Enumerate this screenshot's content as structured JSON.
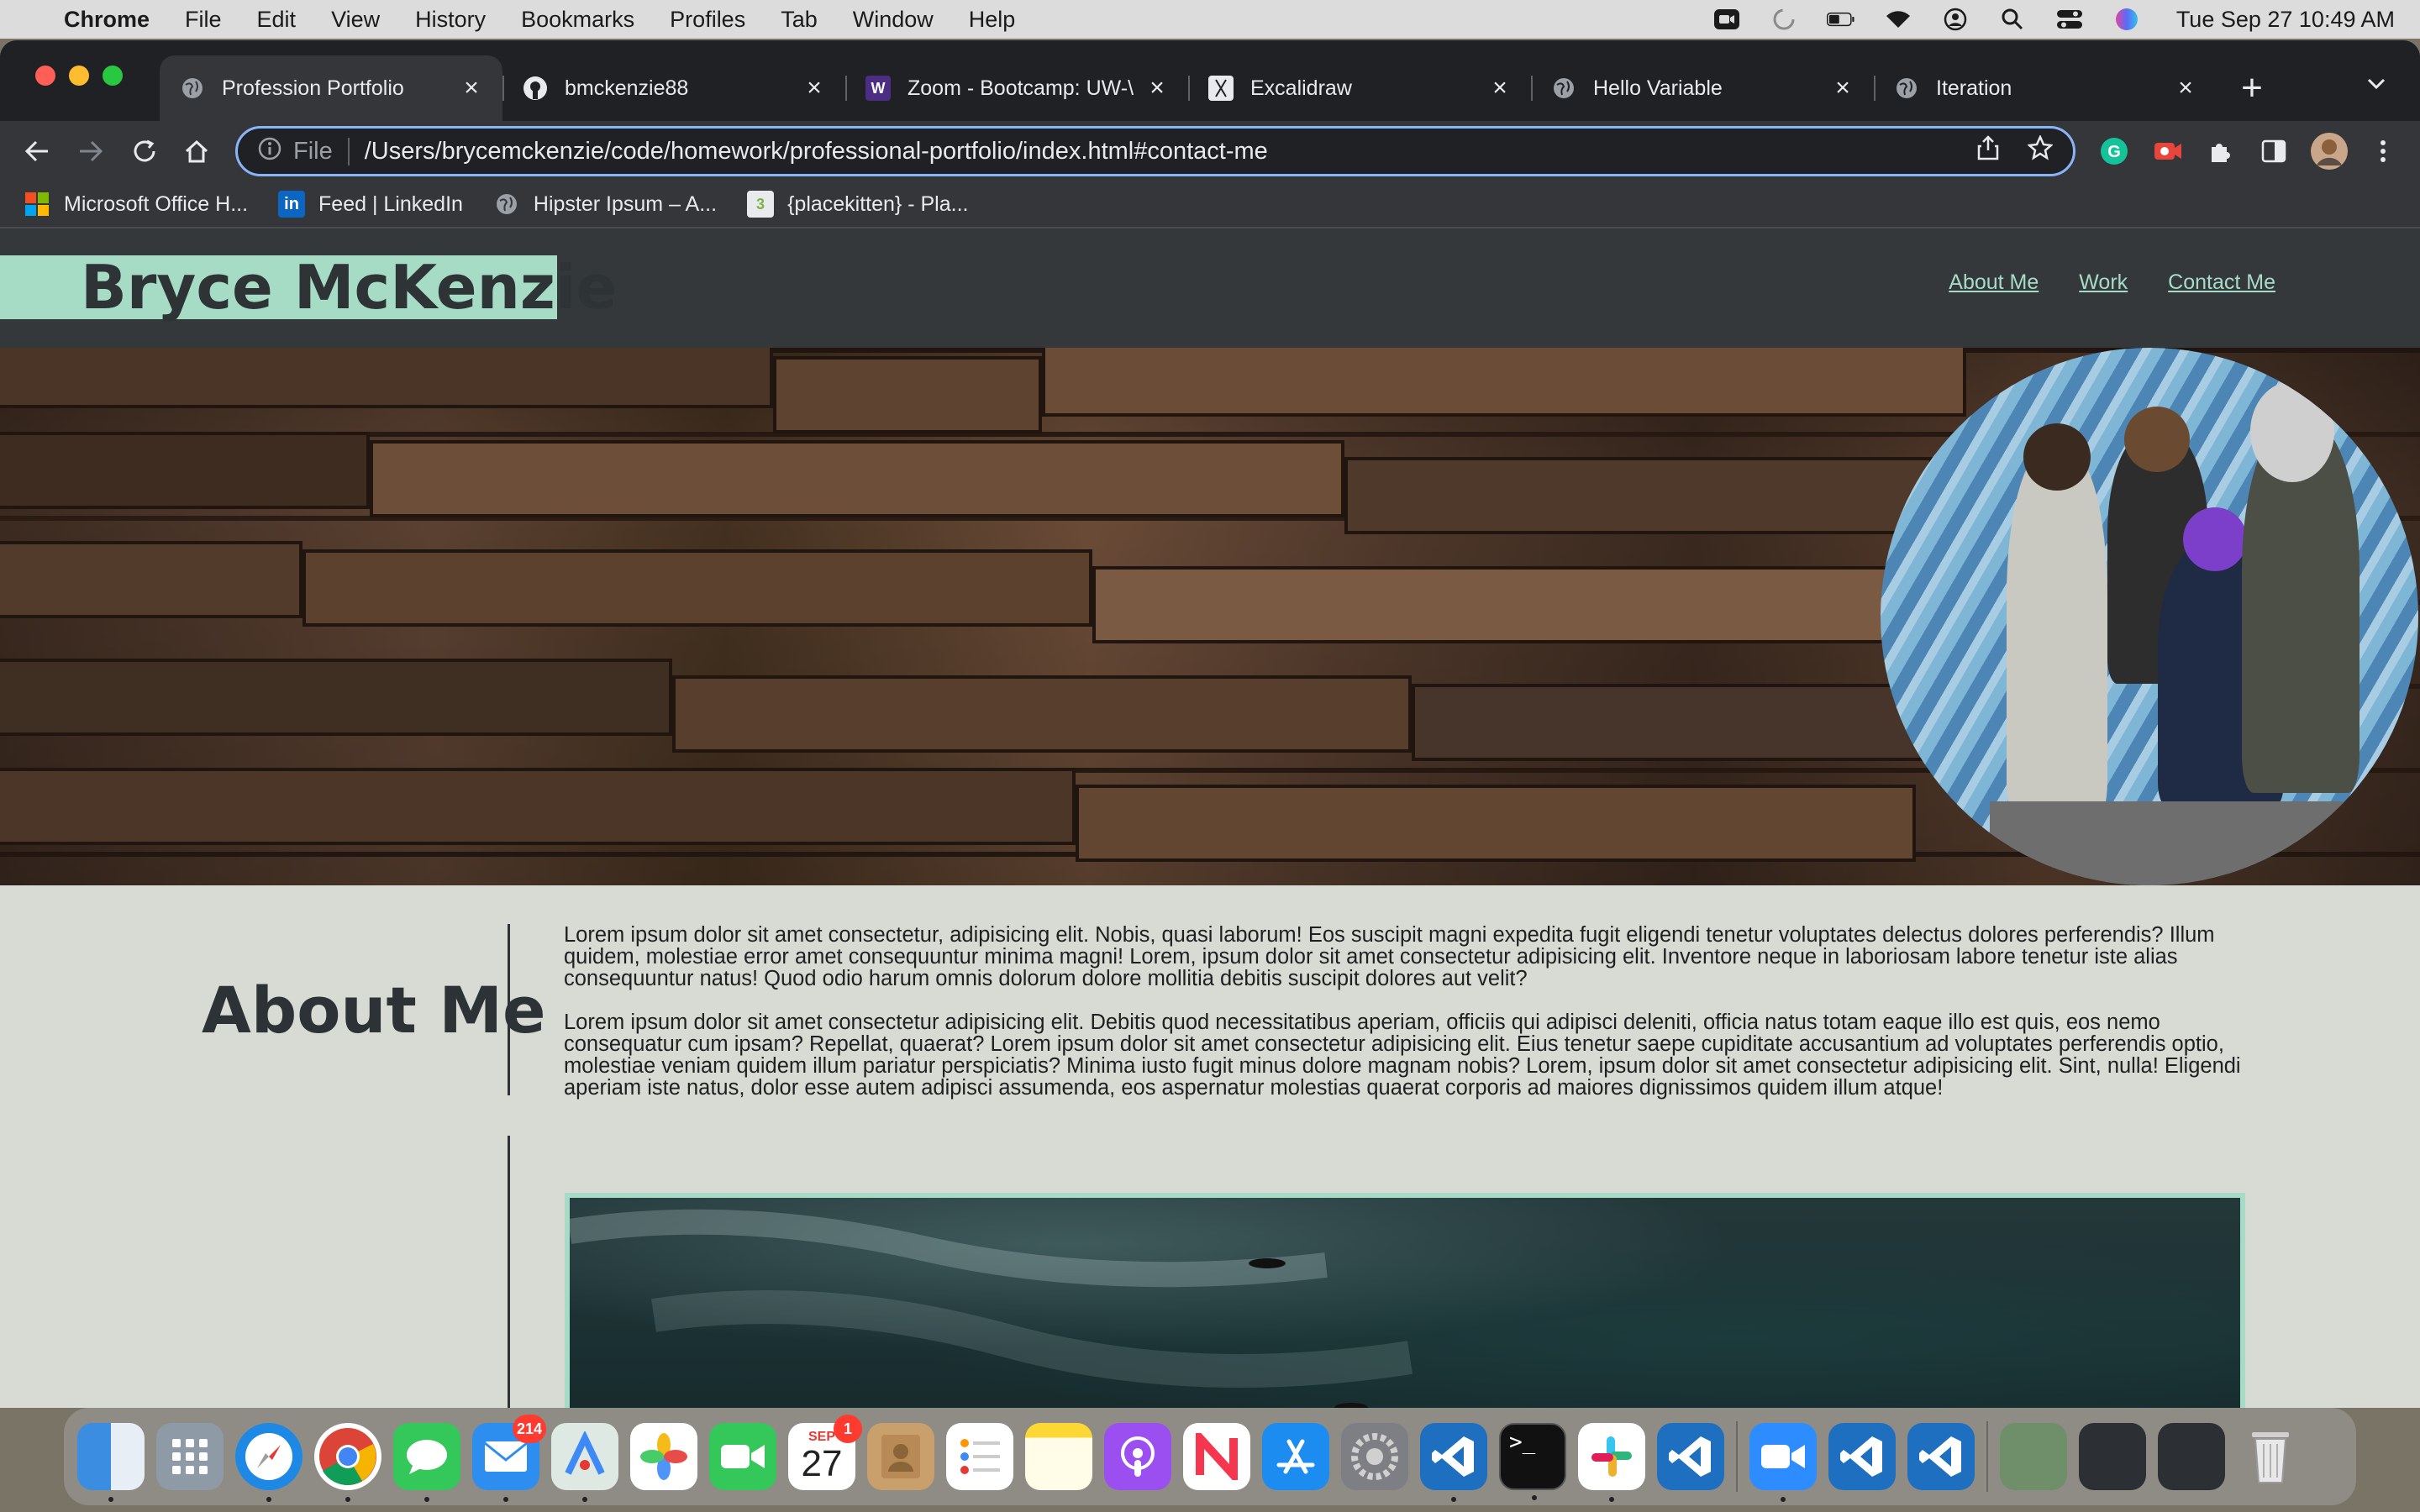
{
  "menubar": {
    "app": "Chrome",
    "items": [
      "File",
      "Edit",
      "View",
      "History",
      "Bookmarks",
      "Profiles",
      "Tab",
      "Window",
      "Help"
    ],
    "clock": "Tue Sep 27  10:49 AM"
  },
  "tabs": [
    {
      "title": "Profession Portfolio",
      "icon": "globe-icon"
    },
    {
      "title": "bmckenzie88",
      "icon": "github-icon"
    },
    {
      "title": "Zoom - Bootcamp: UW-\\",
      "icon": "w-logo-icon"
    },
    {
      "title": "Excalidraw",
      "icon": "excalidraw-icon"
    },
    {
      "title": "Hello Variable",
      "icon": "globe-icon"
    },
    {
      "title": "Iteration",
      "icon": "globe-icon"
    }
  ],
  "omnibox": {
    "scheme": "File",
    "url": "/Users/brycemckenzie/code/homework/professional-portfolio/index.html#contact-me"
  },
  "bookmarks": [
    {
      "label": "Microsoft Office H...",
      "icon": "microsoft-icon"
    },
    {
      "label": "Feed | LinkedIn",
      "icon": "linkedin-icon"
    },
    {
      "label": "Hipster Ipsum – A...",
      "icon": "globe-icon"
    },
    {
      "label": "{placekitten} - Pla...",
      "icon": "placekitten-icon"
    }
  ],
  "site": {
    "brand": "Bryce McKenzie",
    "nav": [
      "About Me",
      "Work",
      "Contact Me"
    ],
    "about_title": "About Me",
    "about_p1": "Lorem ipsum dolor sit amet consectetur, adipisicing elit. Nobis, quasi laborum! Eos suscipit magni expedita fugit eligendi tenetur voluptates delectus dolores perferendis? Illum quidem, molestiae error amet consequuntur minima magni! Lorem, ipsum dolor sit amet consectetur adipisicing elit. Inventore neque in laboriosam labore tenetur iste alias consequuntur natus! Quod odio harum omnis dolorum dolore mollitia debitis suscipit dolores aut velit?",
    "about_p2": "Lorem ipsum dolor sit amet consectetur adipisicing elit. Debitis quod necessitatibus aperiam, officiis qui adipisci deleniti, officia natus totam eaque illo est quis, eos nemo consequatur cum ipsam? Repellat, quaerat? Lorem ipsum dolor sit amet consectetur adipisicing elit. Eius tenetur saepe cupiditate accusantium ad voluptates perferendis optio, molestiae veniam quidem illum pariatur perspiciatis? Minima iusto fugit minus dolore magnam nobis? Lorem, ipsum dolor sit amet consectetur adipisicing elit. Sint, nulla! Eligendi aperiam iste natus, dolor esse autem adipisci assumenda, eos aspernatur molestias quaerat corporis ad maiores dignissimos quidem illum atque!",
    "accent": "#a6dcc6",
    "header_bg": "#34383b",
    "page_bg": "#d8dbd4"
  },
  "dock": {
    "mail_badge": "214",
    "calendar_month": "SEP",
    "calendar_day": "27",
    "calendar_badge": "1",
    "apps": [
      "finder-icon",
      "launchpad-icon",
      "safari-icon",
      "chrome-icon",
      "messages-icon",
      "mail-icon",
      "maps-icon",
      "photos-icon",
      "facetime-icon",
      "calendar-icon",
      "contacts-icon",
      "reminders-icon",
      "notes-icon",
      "podcasts-icon",
      "news-icon",
      "app-store-icon",
      "system-preferences-icon",
      "vscode-icon",
      "terminal-icon",
      "slack-icon",
      "vscode-icon",
      "zoom-icon",
      "vscode-icon",
      "vscode-icon",
      "trash-icon"
    ]
  }
}
